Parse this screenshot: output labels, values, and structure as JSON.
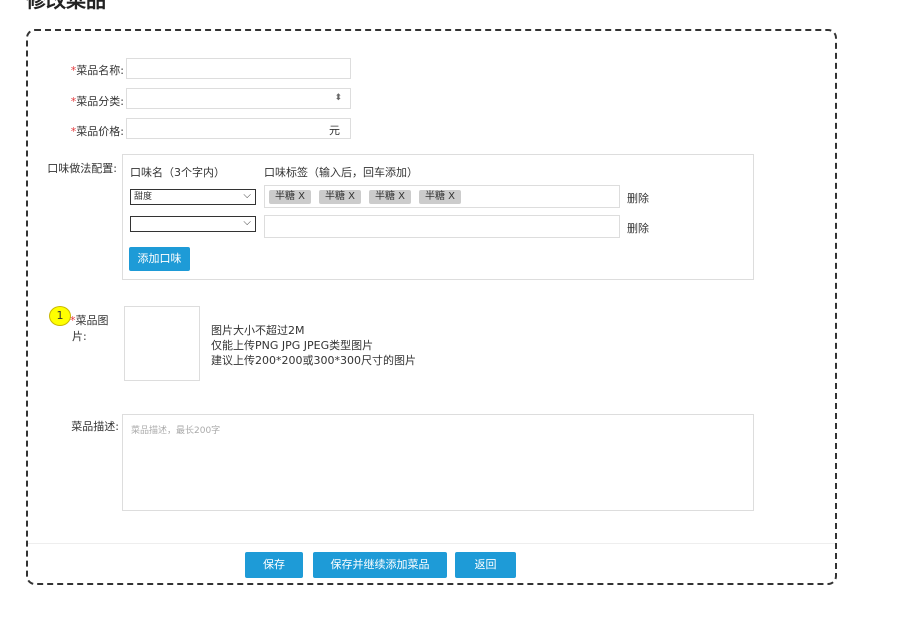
{
  "page": {
    "title": "修改菜品"
  },
  "fields": {
    "name": {
      "label": "菜品名称:",
      "value": ""
    },
    "category": {
      "label": "菜品分类:",
      "value": ""
    },
    "price": {
      "label": "菜品价格:",
      "value": "",
      "suffix": "元"
    }
  },
  "flavor": {
    "label": "口味做法配置:",
    "col_name": "口味名（3个字内）",
    "col_tags": "口味标签（输入后，回车添加）",
    "rows": [
      {
        "select": "甜度",
        "tags": [
          "半糖 X",
          "半糖 X",
          "半糖 X",
          "半糖 X"
        ],
        "delete": "删除"
      },
      {
        "select": "",
        "tags": [],
        "delete": "删除"
      }
    ],
    "add_button": "添加口味"
  },
  "image": {
    "badge": "1",
    "label_line1": "菜品图",
    "label_line2": "片:",
    "hints": [
      "图片大小不超过2M",
      "仅能上传PNG JPG JPEG类型图片",
      "建议上传200*200或300*300尺寸的图片"
    ]
  },
  "description": {
    "label": "菜品描述:",
    "placeholder": "菜品描述，最长200字"
  },
  "buttons": {
    "save": "保存",
    "save_continue": "保存并继续添加菜品",
    "back": "返回"
  },
  "colors": {
    "primary": "#1e9bd7",
    "required": "#e4393c",
    "tag_bg": "#cccccc"
  }
}
